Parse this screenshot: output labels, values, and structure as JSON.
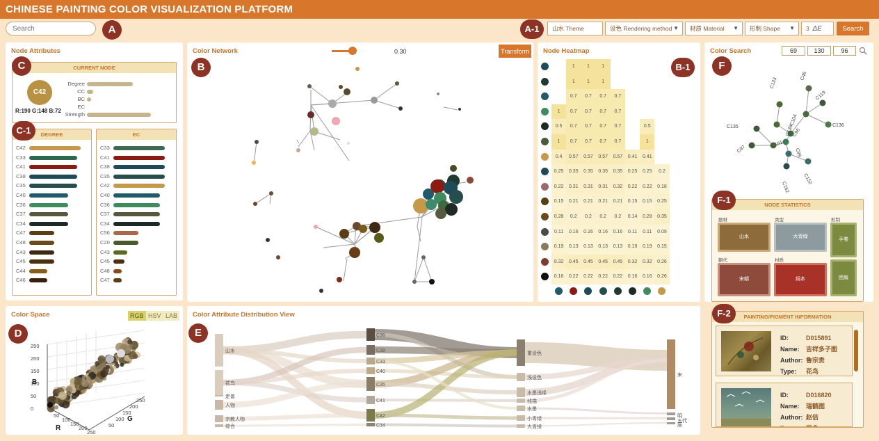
{
  "app": {
    "title": "CHINESE PAINTING COLOR VISUALIZATION PLATFORM"
  },
  "badges": {
    "a": "A",
    "a1": "A-1",
    "b": "B",
    "b1": "B-1",
    "c": "C",
    "c1": "C-1",
    "d": "D",
    "e": "E",
    "f": "F",
    "f1": "F-1",
    "f2": "F-2"
  },
  "search": {
    "placeholder": "Search"
  },
  "toolbar": {
    "theme": "山水 Theme",
    "rendering": "设色 Rendering method",
    "material": "材质 Material",
    "shape": "形制 Shape",
    "delta_value": "3",
    "delta_label": "ΔE",
    "search_label": "Search",
    "dropdown_glyph": "▼"
  },
  "node_attributes": {
    "title": "Node Attributes",
    "current_node_header": "CURRENT NODE",
    "node_id": "C42",
    "node_color": "#b89143",
    "rgb_text": "R:190  G:148  B:72",
    "metrics": [
      {
        "label": "Degree",
        "value": 0.57
      },
      {
        "label": "CC",
        "value": 0.08
      },
      {
        "label": "BC",
        "value": 0.05
      },
      {
        "label": "EC",
        "value": 0.0
      },
      {
        "label": "Strength",
        "value": 0.8
      }
    ],
    "degree_header": "DEGREE",
    "ec_header": "EC",
    "degree_list": [
      {
        "id": "C42",
        "value": 0.92,
        "color": "#c49a4a"
      },
      {
        "id": "C33",
        "value": 0.86,
        "color": "#2f6a4f"
      },
      {
        "id": "C41",
        "value": 0.86,
        "color": "#8a1a12"
      },
      {
        "id": "C38",
        "value": 0.86,
        "color": "#1f4a5a"
      },
      {
        "id": "C35",
        "value": 0.86,
        "color": "#264e4a"
      },
      {
        "id": "C40",
        "value": 0.7,
        "color": "#215a6a"
      },
      {
        "id": "C36",
        "value": 0.7,
        "color": "#3f8a5e"
      },
      {
        "id": "C37",
        "value": 0.7,
        "color": "#555a3e"
      },
      {
        "id": "C34",
        "value": 0.7,
        "color": "#1e2a26"
      },
      {
        "id": "C47",
        "value": 0.45,
        "color": "#5a3e14"
      },
      {
        "id": "C48",
        "value": 0.45,
        "color": "#6a4a1a"
      },
      {
        "id": "C43",
        "value": 0.45,
        "color": "#3e2a12"
      },
      {
        "id": "C45",
        "value": 0.45,
        "color": "#4a3010"
      },
      {
        "id": "C44",
        "value": 0.33,
        "color": "#8a5e1a"
      },
      {
        "id": "C46",
        "value": 0.33,
        "color": "#3a1e10"
      }
    ],
    "ec_list": [
      {
        "id": "C33",
        "value": 0.92,
        "color": "#3e6a52"
      },
      {
        "id": "C41",
        "value": 0.92,
        "color": "#8a1a12"
      },
      {
        "id": "C38",
        "value": 0.92,
        "color": "#1f4a5a"
      },
      {
        "id": "C35",
        "value": 0.92,
        "color": "#264e4a"
      },
      {
        "id": "C42",
        "value": 0.92,
        "color": "#c49a4a"
      },
      {
        "id": "C40",
        "value": 0.84,
        "color": "#215a6a"
      },
      {
        "id": "C36",
        "value": 0.84,
        "color": "#3f8a5e"
      },
      {
        "id": "C37",
        "value": 0.84,
        "color": "#555a3e"
      },
      {
        "id": "C34",
        "value": 0.84,
        "color": "#1e2a26"
      },
      {
        "id": "C56",
        "value": 0.45,
        "color": "#a86a4a"
      },
      {
        "id": "C20",
        "value": 0.45,
        "color": "#4a5a2a"
      },
      {
        "id": "C43",
        "value": 0.25,
        "color": "#5a6a1e"
      },
      {
        "id": "C45",
        "value": 0.2,
        "color": "#4a3010"
      },
      {
        "id": "C48",
        "value": 0.15,
        "color": "#8a4a1a"
      },
      {
        "id": "C47",
        "value": 0.15,
        "color": "#5a3e14"
      }
    ]
  },
  "color_network": {
    "title": "Color Network",
    "slider_value": "0.30",
    "transform_label": "Transform"
  },
  "heatmap": {
    "title": "Node Heatmap",
    "row_colors": [
      "#1e4a5a",
      "#1f3a30",
      "#215a6a",
      "#3f8a5e",
      "#1e2a26",
      "#4a5a3e",
      "#c49a4a",
      "#1f4a5a",
      "#9a6a6a",
      "#5a3e14",
      "#6a4a1a",
      "#4a4a4a",
      "#8a7a5a",
      "#7a3e2a",
      "#111111"
    ],
    "col_colors": [
      "#215a6a",
      "#8a1a12",
      "#1f4a5a",
      "#264e4a",
      "#1f3a30",
      "#1e2a26",
      "#3f8a5e",
      "#c49a4a"
    ],
    "rows": [
      [
        "",
        "1",
        "1",
        "1",
        "",
        "",
        "",
        ""
      ],
      [
        "",
        "1",
        "1",
        "1",
        "",
        "",
        "",
        ""
      ],
      [
        "",
        "0.7",
        "0.7",
        "0.7",
        "0.7",
        "",
        "",
        ""
      ],
      [
        "1",
        "0.7",
        "0.7",
        "0.7",
        "0.7",
        "",
        "",
        ""
      ],
      [
        "0.5",
        "0.7",
        "0.7",
        "0.7",
        "0.7",
        "",
        "0.5",
        ""
      ],
      [
        "1",
        "0.7",
        "0.7",
        "0.7",
        "0.7",
        "",
        "1",
        ""
      ],
      [
        "0.4",
        "0.57",
        "0.57",
        "0.57",
        "0.57",
        "0.41",
        "0.41",
        ""
      ],
      [
        "0.25",
        "0.35",
        "0.35",
        "0.35",
        "0.35",
        "0.25",
        "0.25",
        "0.2"
      ],
      [
        "0.22",
        "0.31",
        "0.31",
        "0.31",
        "0.32",
        "0.22",
        "0.22",
        "0.18"
      ],
      [
        "0.15",
        "0.21",
        "0.21",
        "0.21",
        "0.21",
        "0.15",
        "0.15",
        "0.25"
      ],
      [
        "0.28",
        "0.2",
        "0.2",
        "0.2",
        "0.2",
        "0.14",
        "0.28",
        "0.35"
      ],
      [
        "0.11",
        "0.16",
        "0.16",
        "0.16",
        "0.16",
        "0.11",
        "0.11",
        "0.09"
      ],
      [
        "0.19",
        "0.13",
        "0.13",
        "0.13",
        "0.13",
        "0.19",
        "0.19",
        "0.15"
      ],
      [
        "0.32",
        "0.45",
        "0.45",
        "0.45",
        "0.45",
        "0.32",
        "0.32",
        "0.26"
      ],
      [
        "0.16",
        "0.22",
        "0.22",
        "0.22",
        "0.22",
        "0.16",
        "0.16",
        "0.26"
      ]
    ]
  },
  "color_search": {
    "title": "Color Search",
    "r": "69",
    "g": "130",
    "b": "96",
    "nodes": [
      "C133",
      "C46",
      "C119",
      "C136",
      "C152",
      "C162",
      "C97",
      "C135",
      "C104",
      "C138",
      "C96",
      "C101",
      "C99"
    ]
  },
  "node_statistics": {
    "header": "NODE STATISTICS",
    "cat_theme": "题材",
    "cat_type": "类型",
    "cat_shape": "形制",
    "cat_era": "朝代",
    "cat_material": "材质",
    "theme_value": "山水",
    "type_value": "大青绿",
    "era_value": "宋朝",
    "material_value": "绢本",
    "shape_value_1": "手卷",
    "shape_value_2": "团扇"
  },
  "painting_info": {
    "header": "PAINTING/PIGMENT INFORMATION",
    "id_label": "ID:",
    "name_label": "Name:",
    "author_label": "Author:",
    "type_label": "Type:",
    "items": [
      {
        "id": "D015891",
        "name": "吉祥多子图",
        "author": "鲁宗贵",
        "type": "花鸟"
      },
      {
        "id": "D016820",
        "name": "瑞鹤图",
        "author": "赵佶",
        "type": "花鸟"
      }
    ]
  },
  "color_space": {
    "title": "Color Space",
    "mode_rgb": "RGB",
    "mode_hsv": "HSV",
    "mode_lab": "LAB",
    "axis_b": "B",
    "axis_r": "R",
    "axis_g": "G",
    "ticks_b": [
      "250",
      "200",
      "150",
      "100",
      "50",
      "0"
    ],
    "ticks_r": [
      "50",
      "100",
      "150",
      "200",
      "250"
    ],
    "ticks_g": [
      "50",
      "100",
      "150",
      "200",
      "250"
    ]
  },
  "distribution": {
    "title": "Color Attribute Distribution View",
    "themes": [
      "山水",
      "花鸟",
      "走兽",
      "人物",
      "宗教人物",
      "综合"
    ],
    "colors": [
      "C36",
      "C38",
      "C33",
      "C40",
      "C35",
      "C41",
      "C42",
      "C34"
    ],
    "renders": [
      "重设色",
      "浅设色",
      "水墨浅绛",
      "线描",
      "水墨",
      "小青绿",
      "大青绿"
    ],
    "eras": [
      "宋",
      "明",
      "五代",
      "唐"
    ]
  }
}
